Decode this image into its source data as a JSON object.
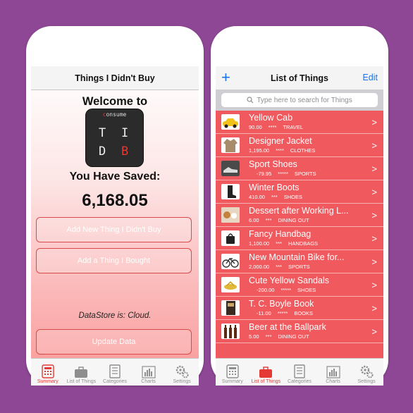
{
  "left": {
    "nav_title": "Things I Didn't Buy",
    "welcome": "Welcome to",
    "logo": {
      "consume_prefix": "c",
      "consume_rest": "onsume",
      "t": "T",
      "i": "I",
      "d": "D",
      "b": "B"
    },
    "saved_label": "You Have Saved:",
    "saved_value": "6,168.05",
    "buttons": {
      "add_didnt_buy": "Add New Thing I Didn't Buy",
      "add_bought": "Add a Thing I Bought",
      "update": "Update Data"
    },
    "datastore": "DataStore is: Cloud."
  },
  "right": {
    "nav_title": "List of Things",
    "plus": "+",
    "edit": "Edit",
    "search_placeholder": "Type here to search for Things",
    "items": [
      {
        "name": "Yellow Cab",
        "amount": "90.00",
        "stars": "****",
        "category": "TRAVEL",
        "icon": "taxi-icon"
      },
      {
        "name": "Designer Jacket",
        "amount": "1,195.00",
        "stars": "****",
        "category": "CLOTHES",
        "icon": "jacket-icon"
      },
      {
        "name": "Sport Shoes",
        "amount": "-79.95",
        "stars": "*****",
        "category": "SPORTS",
        "icon": "sneaker-icon"
      },
      {
        "name": "Winter Boots",
        "amount": "410.00",
        "stars": "***",
        "category": "SHOES",
        "icon": "boot-icon"
      },
      {
        "name": "Dessert after Working L...",
        "amount": "6.00",
        "stars": "***",
        "category": "DINING OUT",
        "icon": "dessert-icon"
      },
      {
        "name": "Fancy Handbag",
        "amount": "1,100.00",
        "stars": "***",
        "category": "HANDBAGS",
        "icon": "handbag-icon"
      },
      {
        "name": "New Mountain Bike for...",
        "amount": "2,000.00",
        "stars": "***",
        "category": "SPORTS",
        "icon": "bike-icon"
      },
      {
        "name": "Cute Yellow Sandals",
        "amount": "-200.00",
        "stars": "*****",
        "category": "SHOES",
        "icon": "sandal-icon"
      },
      {
        "name": "T. C. Boyle Book",
        "amount": "-11.00",
        "stars": "*****",
        "category": "BOOKS",
        "icon": "book-icon"
      },
      {
        "name": "Beer at the Ballpark",
        "amount": "5.00",
        "stars": "***",
        "category": "DINING OUT",
        "icon": "beer-icon"
      }
    ]
  },
  "tabs": [
    "Summary",
    "List of Things",
    "Categories",
    "Charts",
    "Settings"
  ],
  "colors": {
    "background": "#8e4795",
    "accent_red": "#e53935",
    "row_red": "#f05a5e",
    "link_blue": "#1a73e8"
  }
}
